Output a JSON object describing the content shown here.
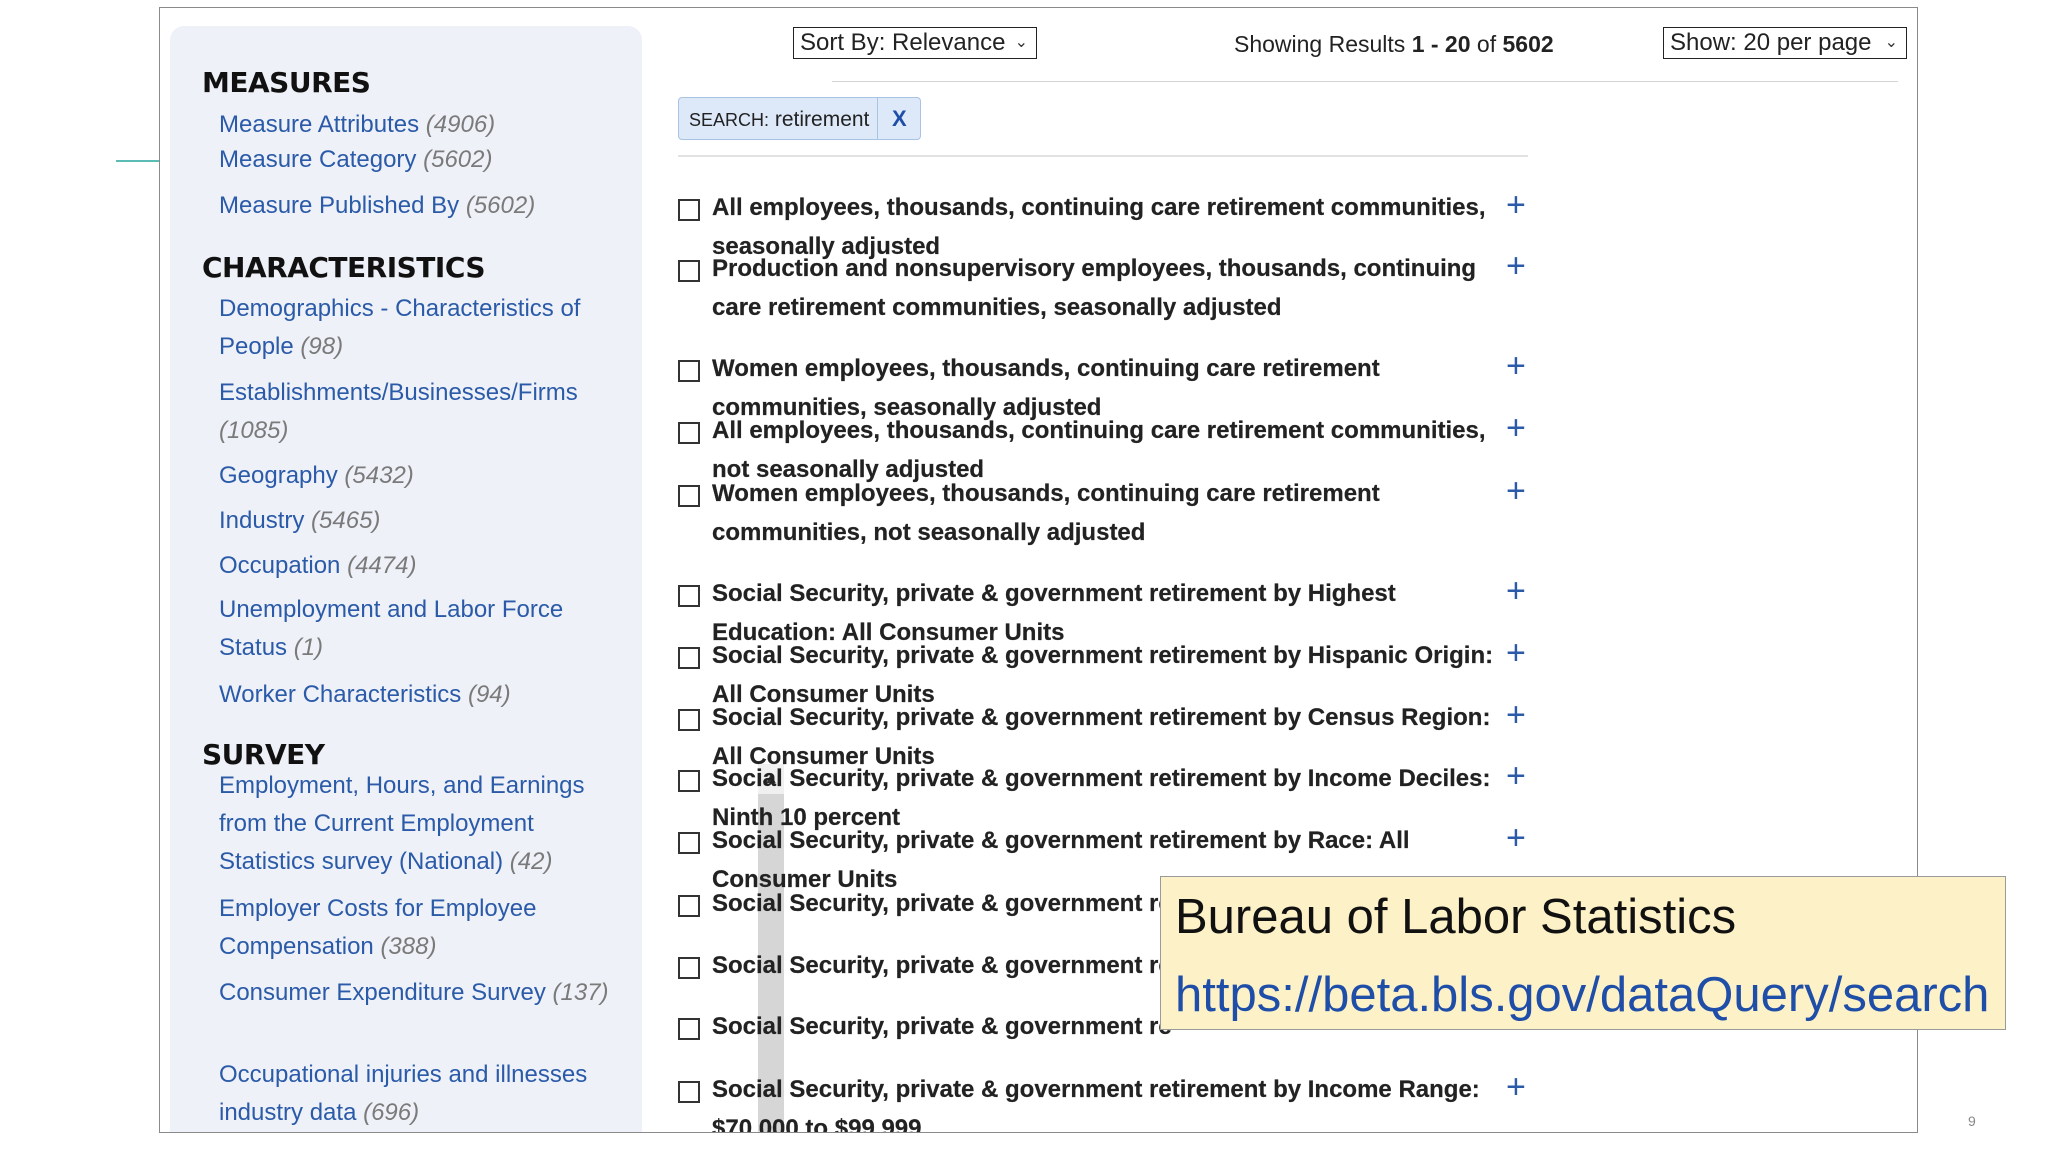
{
  "sidebar": {
    "measures": {
      "title": "MEASURES",
      "items": [
        {
          "label": "Measure Attributes",
          "count": "(4906)"
        },
        {
          "label": "Measure Category",
          "count": "(5602)"
        },
        {
          "label": "Measure Published By",
          "count": "(5602)"
        }
      ]
    },
    "characteristics": {
      "title": "CHARACTERISTICS",
      "items": [
        {
          "label": "Demographics - Characteristics of People",
          "count": "(98)"
        },
        {
          "label": "Establishments/Businesses/Firms",
          "count": "(1085)"
        },
        {
          "label": "Geography",
          "count": "(5432)"
        },
        {
          "label": "Industry",
          "count": "(5465)"
        },
        {
          "label": "Occupation",
          "count": "(4474)"
        },
        {
          "label": "Unemployment and Labor Force Status",
          "count": "(1)"
        },
        {
          "label": "Worker Characteristics",
          "count": "(94)"
        }
      ]
    },
    "survey": {
      "title": "SURVEY",
      "items": [
        {
          "label": "Employment, Hours, and Earnings from the Current Employment Statistics survey (National)",
          "count": "(42)"
        },
        {
          "label": "Employer Costs for Employee Compensation",
          "count": "(388)"
        },
        {
          "label": "Consumer Expenditure Survey",
          "count": "(137)"
        },
        {
          "label": "Occupational injuries and illnesses industry data",
          "count": "(696)"
        }
      ]
    }
  },
  "toolbar": {
    "sort_label": "Sort By: Relevance",
    "show_label": "Show: 20 per page",
    "results_prefix": "Showing Results ",
    "results_range": "1 - 20",
    "results_of": " of ",
    "results_total": "5602"
  },
  "filter_chip": {
    "key": "SEARCH:",
    "value": "retirement",
    "remove": "X"
  },
  "results": [
    "All employees, thousands, continuing care retirement communities, seasonally adjusted",
    "Production and nonsupervisory employees, thousands, continuing care retirement communities, seasonally adjusted",
    "Women employees, thousands, continuing care retirement communities, seasonally adjusted",
    "All employees, thousands, continuing care retirement communities, not seasonally adjusted",
    "Women employees, thousands, continuing care retirement communities, not seasonally adjusted",
    "Social Security, private & government retirement by Highest Education: All Consumer Units",
    "Social Security, private & government retirement by Hispanic Origin: All Consumer Units",
    "Social Security, private & government retirement by Census Region: All Consumer Units",
    "Social Security, private & government retirement by Income Deciles: Ninth 10 percent",
    "Social Security, private & government retirement by Race: All Consumer Units",
    "Social Security, private & government re",
    "Social Security, private & government re",
    "Social Security, private & government re",
    "Social Security, private & government retirement by Income Range: $70,000 to $99,999"
  ],
  "callout": {
    "title": "Bureau of Labor Statistics",
    "url": "https://beta.bls.gov/dataQuery/search"
  },
  "page_number": "9",
  "icons": {
    "expand": "plus-icon",
    "dropdown": "chevron-down-icon",
    "scroll": "scroll-up-arrow-icon"
  }
}
